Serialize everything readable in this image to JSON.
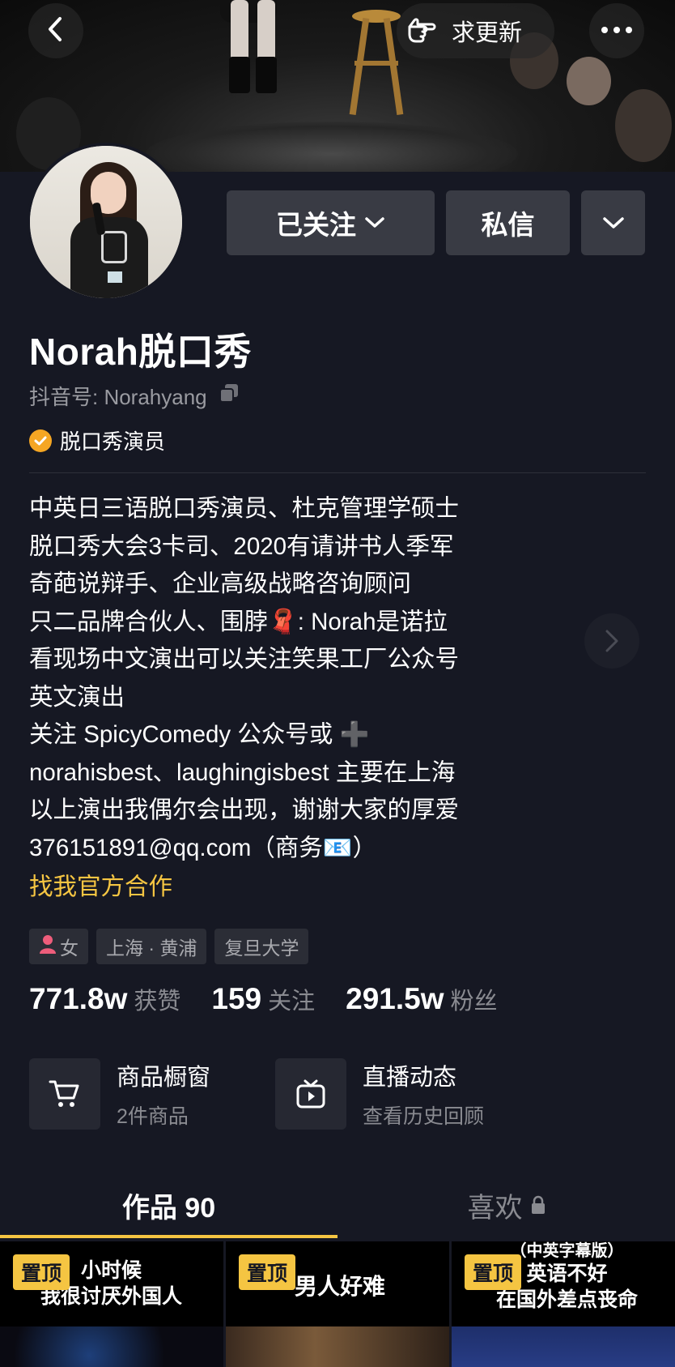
{
  "header": {
    "request_update_label": "求更新"
  },
  "profile": {
    "name": "Norah脱口秀",
    "douyin_id": "抖音号: Norahyang",
    "role": "脱口秀演员",
    "follow_label": "已关注",
    "message_label": "私信"
  },
  "bio": {
    "lines": [
      "中英日三语脱口秀演员、杜克管理学硕士",
      "脱口秀大会3卡司、2020有请讲书人季军",
      "奇葩说辩手、企业高级战略咨询顾问",
      "只二品牌合伙人、围脖🧣: Norah是诺拉",
      "看现场中文演出可以关注笑果工厂公众号",
      "英文演出",
      "关注 SpicyComedy 公众号或 ➕",
      "norahisbest、laughingisbest 主要在上海",
      "以上演出我偶尔会出现，谢谢大家的厚爱",
      "376151891@qq.com（商务📧）"
    ],
    "cooperation_link": "找我官方合作"
  },
  "tags": {
    "gender": "女",
    "location": "上海 · 黄浦",
    "school": "复旦大学"
  },
  "stats": {
    "likes_value": "771.8w",
    "likes_label": "获赞",
    "following_value": "159",
    "following_label": "关注",
    "followers_value": "291.5w",
    "followers_label": "粉丝"
  },
  "services": {
    "shop_title": "商品橱窗",
    "shop_sub": "2件商品",
    "live_title": "直播动态",
    "live_sub": "查看历史回顾"
  },
  "tabs": {
    "works_label": "作品 90",
    "likes_label": "喜欢"
  },
  "videos": [
    {
      "pin_label": "置顶",
      "title_line1": "小时候",
      "title_line2": "我很讨厌外国人"
    },
    {
      "pin_label": "置顶",
      "title_line1": "男人好难"
    },
    {
      "pin_label": "置顶",
      "caption_top": "（中英字幕版）",
      "title_line1": "英语不好",
      "title_line2": "在国外差点丧命"
    }
  ],
  "colors": {
    "background": "#161823",
    "accent": "#f5c542",
    "button": "#393b44",
    "muted_text": "#8a8b91"
  }
}
